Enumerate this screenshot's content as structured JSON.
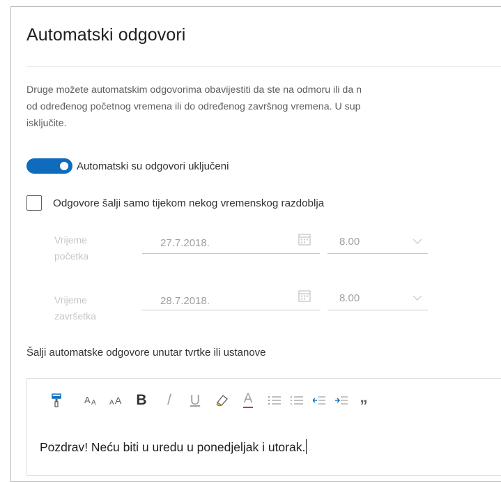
{
  "dialog": {
    "title": "Automatski odgovori",
    "description_lines": [
      "Druge možete automatskim odgovorima obavijestiti da ste na odmoru ili da n",
      "od određenog početnog vremena ili do određenog završnog vremena. U sup",
      "isključite."
    ]
  },
  "auto_reply_toggle": {
    "label": "Automatski su odgovori uključeni",
    "state": "on"
  },
  "time_period_checkbox": {
    "label": "Odgovore šalji samo tijekom nekog vremenskog razdoblja",
    "checked": false
  },
  "start": {
    "label_line1": "Vrijeme",
    "label_line2": "početka",
    "date": "27.7.2018.",
    "time": "8.00"
  },
  "end": {
    "label_line1": "Vrijeme",
    "label_line2": "završetka",
    "date": "28.7.2018.",
    "time": "8.00"
  },
  "inside_org": {
    "label": "Šalji automatske odgovore unutar tvrtke ili ustanove",
    "message": "Pozdrav! Neću biti u uredu u ponedjeljak i utorak."
  },
  "toolbar": {
    "icons": [
      "format-painter-icon",
      "font-size-decrease-icon",
      "font-size-increase-icon",
      "bold-icon",
      "italic-icon",
      "underline-icon",
      "highlight-icon",
      "font-color-icon",
      "bullets-icon",
      "numbering-icon",
      "decrease-indent-icon",
      "increase-indent-icon",
      "quote-icon"
    ],
    "glyphs": {
      "bold": "B",
      "italic": "/",
      "underline": "U",
      "font_color": "A",
      "quote": "”"
    }
  },
  "colors": {
    "accent": "#0f6cbd",
    "text": "#323130",
    "disabled": "#c8c6c4",
    "font_color_underline": "#d13438"
  }
}
